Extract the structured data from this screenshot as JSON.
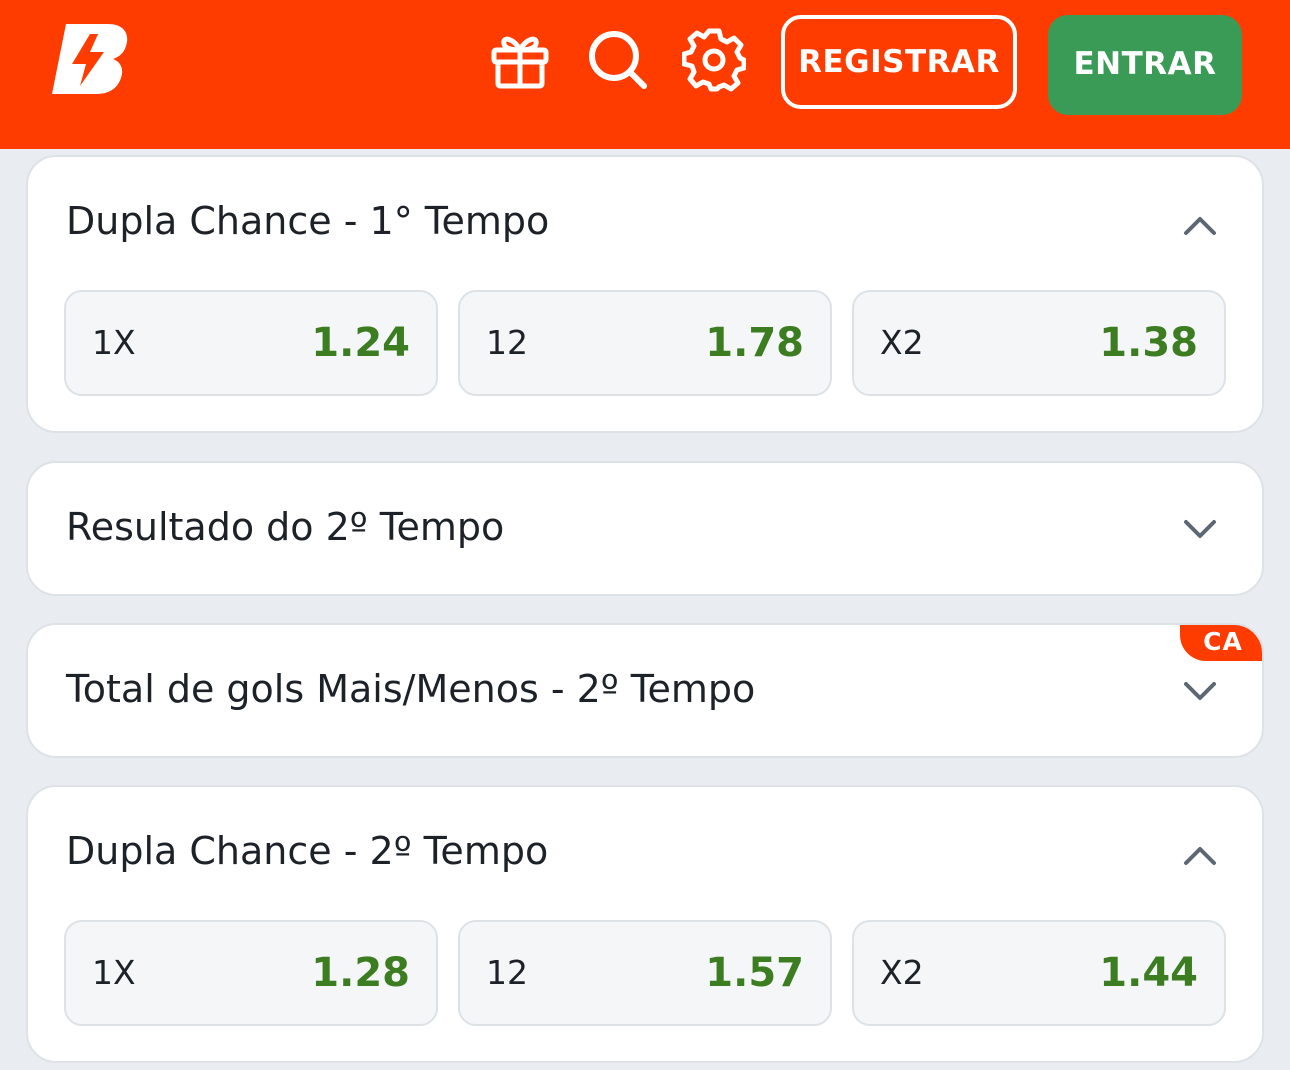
{
  "header": {
    "logo_icon": "brand-b-logo",
    "icons": [
      "gift-icon",
      "search-icon",
      "gear-icon"
    ],
    "register_label": "REGISTRAR",
    "login_label": "ENTRAR",
    "brand_color": "#ff3c00",
    "login_color": "#3a9b57"
  },
  "markets": [
    {
      "title": "Dupla Chance - 1° Tempo",
      "expanded": true,
      "odds": [
        {
          "label": "1X",
          "value": "1.24"
        },
        {
          "label": "12",
          "value": "1.78"
        },
        {
          "label": "X2",
          "value": "1.38"
        }
      ]
    },
    {
      "title": "Resultado do 2º Tempo",
      "expanded": false
    },
    {
      "title": "Total de gols Mais/Menos - 2º Tempo",
      "expanded": false,
      "badge": "CA"
    },
    {
      "title": "Dupla Chance - 2º Tempo",
      "expanded": true,
      "odds": [
        {
          "label": "1X",
          "value": "1.28"
        },
        {
          "label": "12",
          "value": "1.57"
        },
        {
          "label": "X2",
          "value": "1.44"
        }
      ]
    }
  ],
  "odds_color": "#3d7d21"
}
